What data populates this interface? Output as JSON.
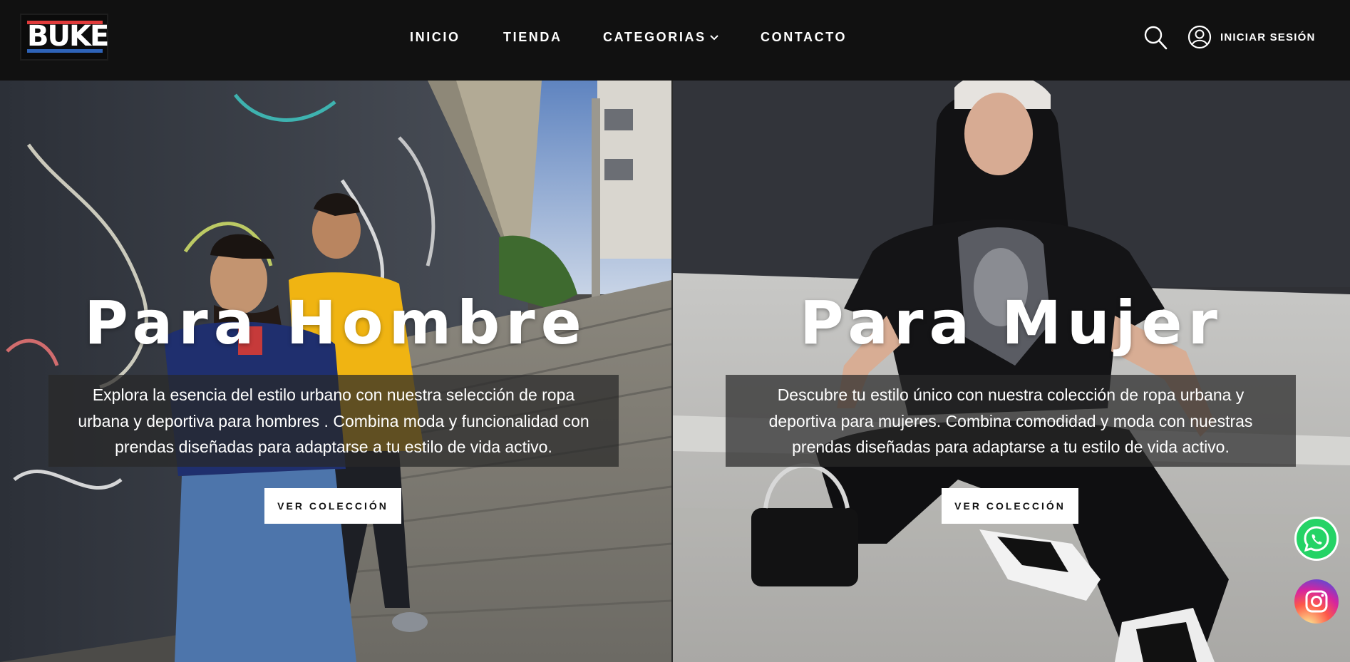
{
  "brand": {
    "logo_text": "BUKE",
    "colors": {
      "red": "#e03a3a",
      "blue": "#2e63b8"
    }
  },
  "nav": {
    "items": [
      {
        "label": "INICIO"
      },
      {
        "label": "TIENDA"
      },
      {
        "label": "CATEGORIAS",
        "icon": "chevron-down-icon"
      },
      {
        "label": "CONTACTO"
      }
    ]
  },
  "header": {
    "search_icon": "search-icon",
    "login_icon": "user-circle-icon",
    "login_label": "INICIAR SESIÓN"
  },
  "hero": {
    "left": {
      "title": "Para Hombre",
      "description_lines": [
        "Explora la esencia del estilo urbano con nuestra selección de ropa",
        "urbana y deportiva para hombres . Combina moda y funcionalidad con",
        "prendas diseñadas para adaptarse a tu estilo de vida activo."
      ],
      "button_label": "VER COLECCIÓN",
      "image": "two men in windbreakers on graffiti street stairs"
    },
    "right": {
      "title": "Para Mujer",
      "description_lines": [
        "Descubre tu estilo único con nuestra colección de ropa urbana y",
        "deportiva para mujeres. Combina comodidad y moda con nuestras",
        "prendas diseñadas para adaptarse a tu estilo de vida activo."
      ],
      "button_label": "VER COLECCIÓN",
      "image": "woman in oversized black graphic tee crouching on concrete"
    }
  },
  "floating": {
    "whatsapp_icon": "whatsapp-icon",
    "instagram_icon": "instagram-icon",
    "whatsapp_color": "#25D366"
  }
}
